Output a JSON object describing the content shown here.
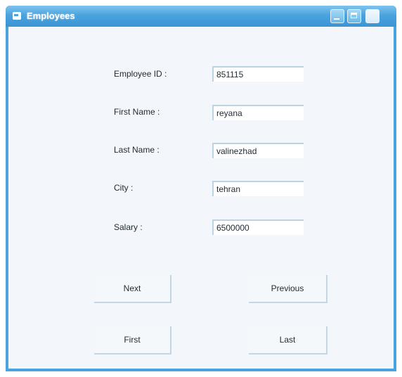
{
  "window": {
    "title": "Employees"
  },
  "form": {
    "fields": [
      {
        "label": "Employee ID :",
        "value": "851115"
      },
      {
        "label": "First Name :",
        "value": "reyana"
      },
      {
        "label": "Last Name :",
        "value": "valinezhad"
      },
      {
        "label": "City :",
        "value": "tehran"
      },
      {
        "label": "Salary :",
        "value": "6500000"
      }
    ]
  },
  "buttons": {
    "next": "Next",
    "previous": "Previous",
    "first": "First",
    "last": "Last"
  },
  "icons": {
    "app": "form-window-icon",
    "minimize": "minimize-icon",
    "maximize": "maximize-icon",
    "close": "close-icon"
  }
}
